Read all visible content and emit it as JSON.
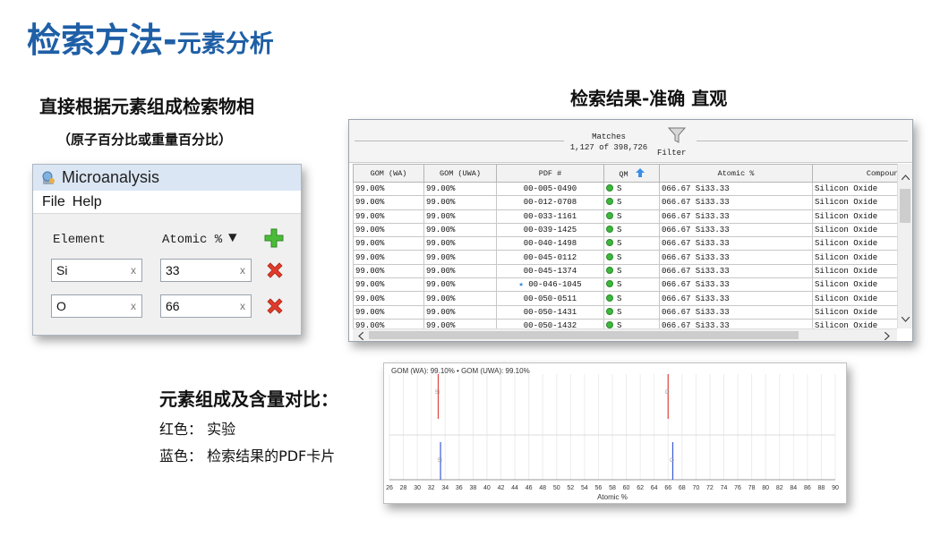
{
  "slide": {
    "title_main": "检索方法-",
    "title_sub": "元素分析",
    "left_heading": "直接根据元素组成检索物相",
    "left_subheading": "（原子百分比或重量百分比）",
    "right_heading": "检索结果-准确 直观",
    "compare_heading": "元素组成及含量对比：",
    "legend_red": "红色：  实验",
    "legend_blue": "蓝色：  检索结果的PDF卡片"
  },
  "micro_dialog": {
    "title": "Microanalysis",
    "menu": [
      "File",
      "Help"
    ],
    "col_element": "Element",
    "col_atomic": "Atomic %",
    "sort_glyph": "▼",
    "add_glyph": "+",
    "clear_glyph": "x",
    "rows": [
      {
        "element": "Si",
        "atomic": "33"
      },
      {
        "element": "O",
        "atomic": "66"
      }
    ]
  },
  "matches_dialog": {
    "matches_label": "Matches",
    "matches_count": "1,127 of 398,726",
    "filter_label": "Filter",
    "columns": [
      "GOM (WA)",
      "GOM (UWA)",
      "PDF #",
      "QM",
      "Atomic %",
      "Compound Name"
    ],
    "rows": [
      {
        "gom_wa": "99.00%",
        "gom_uwa": "99.00%",
        "pdf": "00-005-0490",
        "qm": "S",
        "atomic": "066.67 Si33.33",
        "name": "Silicon Oxide",
        "star": false
      },
      {
        "gom_wa": "99.00%",
        "gom_uwa": "99.00%",
        "pdf": "00-012-0708",
        "qm": "S",
        "atomic": "066.67 Si33.33",
        "name": "Silicon Oxide",
        "star": false
      },
      {
        "gom_wa": "99.00%",
        "gom_uwa": "99.00%",
        "pdf": "00-033-1161",
        "qm": "S",
        "atomic": "066.67 Si33.33",
        "name": "Silicon Oxide",
        "star": false
      },
      {
        "gom_wa": "99.00%",
        "gom_uwa": "99.00%",
        "pdf": "00-039-1425",
        "qm": "S",
        "atomic": "066.67 Si33.33",
        "name": "Silicon Oxide",
        "star": false
      },
      {
        "gom_wa": "99.00%",
        "gom_uwa": "99.00%",
        "pdf": "00-040-1498",
        "qm": "S",
        "atomic": "066.67 Si33.33",
        "name": "Silicon Oxide",
        "star": false
      },
      {
        "gom_wa": "99.00%",
        "gom_uwa": "99.00%",
        "pdf": "00-045-0112",
        "qm": "S",
        "atomic": "066.67 Si33.33",
        "name": "Silicon Oxide",
        "star": false
      },
      {
        "gom_wa": "99.00%",
        "gom_uwa": "99.00%",
        "pdf": "00-045-1374",
        "qm": "S",
        "atomic": "066.67 Si33.33",
        "name": "Silicon Oxide",
        "star": false
      },
      {
        "gom_wa": "99.00%",
        "gom_uwa": "99.00%",
        "pdf": "00-046-1045",
        "qm": "S",
        "atomic": "066.67 Si33.33",
        "name": "Silicon Oxide",
        "star": true
      },
      {
        "gom_wa": "99.00%",
        "gom_uwa": "99.00%",
        "pdf": "00-050-0511",
        "qm": "S",
        "atomic": "066.67 Si33.33",
        "name": "Silicon Oxide",
        "star": false
      },
      {
        "gom_wa": "99.00%",
        "gom_uwa": "99.00%",
        "pdf": "00-050-1431",
        "qm": "S",
        "atomic": "066.67 Si33.33",
        "name": "Silicon Oxide",
        "star": false
      },
      {
        "gom_wa": "99.00%",
        "gom_uwa": "99.00%",
        "pdf": "00-050-1432",
        "qm": "S",
        "atomic": "066.67 Si33.33",
        "name": "Silicon Oxide",
        "star": false
      }
    ]
  },
  "plot_panel": {
    "legend_text": "GOM (WA): 99.10% • GOM (UWA): 99.10%",
    "colors": {
      "experiment": "#e0443a",
      "pdf_card": "#3b5bd6"
    }
  },
  "chart_data": {
    "type": "bar",
    "xlabel": "Atomic %",
    "xlim": [
      26,
      90
    ],
    "x_ticks": [
      26,
      28,
      30,
      32,
      34,
      36,
      38,
      40,
      42,
      44,
      46,
      48,
      50,
      52,
      54,
      56,
      58,
      60,
      62,
      64,
      66,
      68,
      70,
      72,
      74,
      76,
      78,
      80,
      82,
      84,
      86,
      88,
      90
    ],
    "series": [
      {
        "name": "实验",
        "color": "#e0443a",
        "values": [
          {
            "element": "Si",
            "x": 33
          },
          {
            "element": "O",
            "x": 66
          }
        ]
      },
      {
        "name": "PDF卡片",
        "color": "#3b5bd6",
        "values": [
          {
            "element": "Si",
            "x": 33.33
          },
          {
            "element": "O",
            "x": 66.67
          }
        ]
      }
    ]
  }
}
